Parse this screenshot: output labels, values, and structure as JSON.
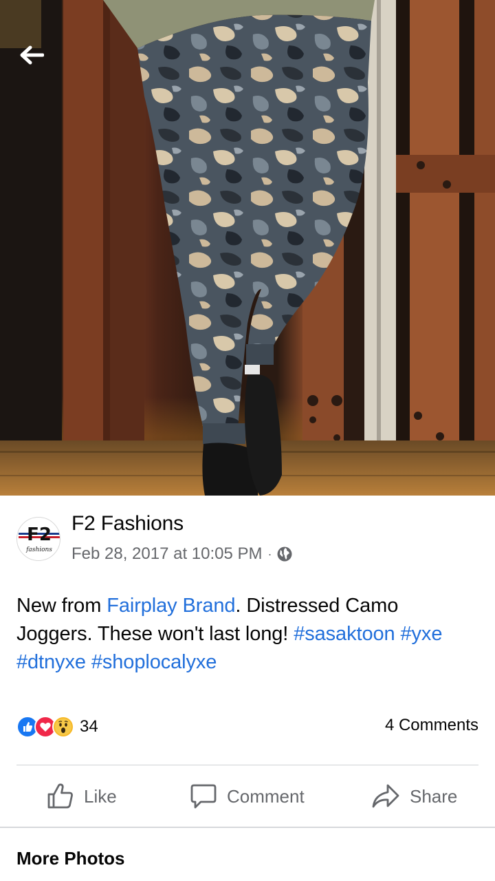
{
  "photo": {
    "alt_subject": "camo-joggers-photo"
  },
  "nav": {
    "back_icon": "arrow-left-icon"
  },
  "post": {
    "page_name": "F2 Fashions",
    "avatar_text": "F2",
    "avatar_subtext": "fashions",
    "date": "Feb 28, 2017 at 10:05 PM",
    "separator": "·",
    "privacy_icon": "globe-icon",
    "text_intro": "New from ",
    "text_link": "Fairplay Brand",
    "text_body": ". Distressed Camo Joggers. These won't last long! ",
    "hashtags": [
      "#sasaktoon",
      "#yxe",
      "#dtnyxe",
      "#shoplocalyxe"
    ]
  },
  "engagement": {
    "reactions": [
      "like-reaction-icon",
      "love-reaction-icon",
      "wow-reaction-icon"
    ],
    "reaction_count": "34",
    "comments_label": "4 Comments"
  },
  "actions": {
    "like_label": "Like",
    "comment_label": "Comment",
    "share_label": "Share"
  },
  "section": {
    "more_photos_label": "More Photos"
  },
  "colors": {
    "link": "#216fdb",
    "secondary_text": "#65676b",
    "like_blue": "#1877f2",
    "love_red": "#f02849",
    "wow_yellow": "#f7b928"
  }
}
